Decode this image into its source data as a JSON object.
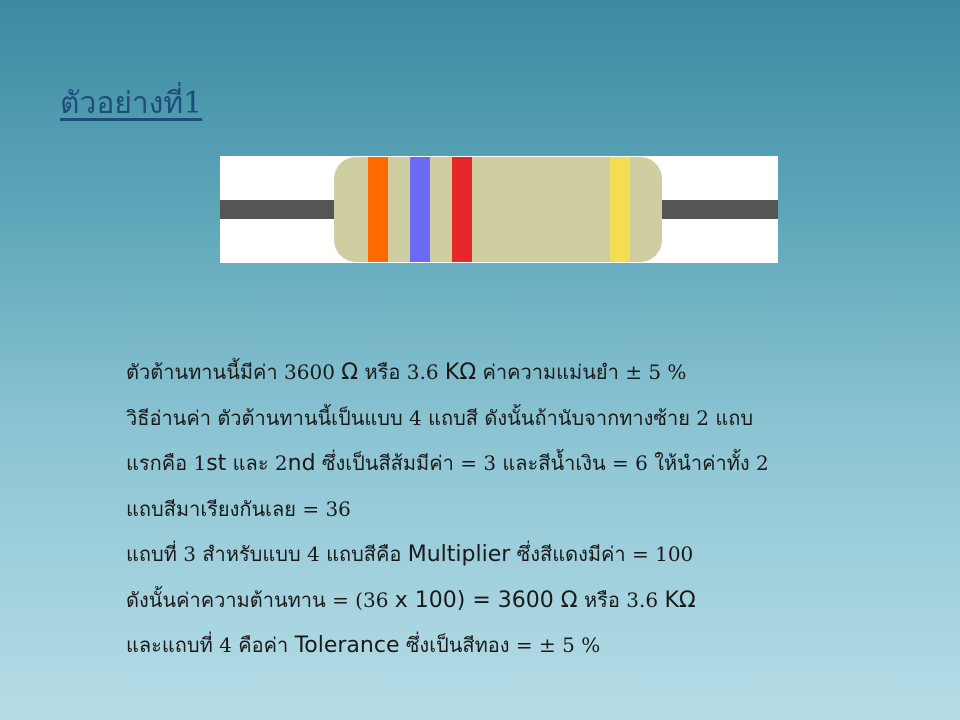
{
  "slide": {
    "title": "ตัวอย่างที่1"
  },
  "resistor": {
    "body_color": "#cfcea0",
    "lead_color": "#555555",
    "bands": [
      {
        "color_name": "orange",
        "color": "#ff6a00"
      },
      {
        "color_name": "blue",
        "color": "#6a6af5"
      },
      {
        "color_name": "red",
        "color": "#e62828"
      },
      {
        "color_name": "gold",
        "color": "#f2de50"
      }
    ]
  },
  "body": {
    "lines": [
      [
        {
          "t": "ตัวต้านทานนี้มีค่า 3600 "
        },
        {
          "t": "Ω",
          "s": 1
        },
        {
          "t": " หรือ 3.6 "
        },
        {
          "t": "KΩ",
          "s": 1
        },
        {
          "t": " ค่าความแม่นยำ ± 5 %"
        }
      ],
      [
        {
          "t": "วิธีอ่านค่า ตัวต้านทานนี้เป็นแบบ 4 แถบสี ดังนั้นถ้านับจากทางซ้าย 2 แถบ"
        }
      ],
      [
        {
          "t": "แรกคือ 1"
        },
        {
          "t": "st",
          "s": 1
        },
        {
          "t": " และ 2"
        },
        {
          "t": "nd",
          "s": 1
        },
        {
          "t": " ซึ่งเป็นสีส้มมีค่า = 3 และสีน้ำเงิน = 6 ให้นำค่าทั้ง 2"
        }
      ],
      [
        {
          "t": "แถบสีมาเรียงกันเลย = 36"
        }
      ],
      [
        {
          "t": "แถบที่ 3 สำหรับแบบ 4 แถบสีคือ "
        },
        {
          "t": "Multiplier",
          "s": 1
        },
        {
          "t": " ซึ่งสีแดงมีค่า = 100"
        }
      ],
      [
        {
          "t": "ดังนั้นค่าความต้านทาน = (36 "
        },
        {
          "t": "x 100) = 3600 Ω",
          "s": 1
        },
        {
          "t": " หรือ 3.6 "
        },
        {
          "t": "KΩ",
          "s": 1
        }
      ],
      [
        {
          "t": "และแถบที่ 4 คือค่า "
        },
        {
          "t": "Tolerance",
          "s": 1
        },
        {
          "t": " ซึ่งเป็นสีทอง = ± 5 %"
        }
      ]
    ]
  }
}
